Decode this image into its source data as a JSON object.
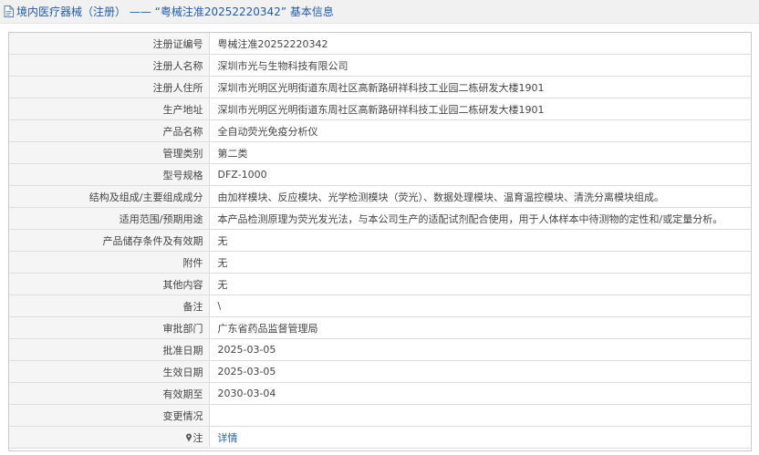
{
  "header": {
    "title": "境内医疗器械（注册） —— “粤械注准20252220342” 基本信息"
  },
  "rows": [
    {
      "label": "注册证编号",
      "value": "粤械注准20252220342"
    },
    {
      "label": "注册人名称",
      "value": "深圳市光与生物科技有限公司"
    },
    {
      "label": "注册人住所",
      "value": "深圳市光明区光明街道东周社区高新路研祥科技工业园二栋研发大楼1901"
    },
    {
      "label": "生产地址",
      "value": "深圳市光明区光明街道东周社区高新路研祥科技工业园二栋研发大楼1901"
    },
    {
      "label": "产品名称",
      "value": "全自动荧光免疫分析仪"
    },
    {
      "label": "管理类别",
      "value": "第二类"
    },
    {
      "label": "型号规格",
      "value": "DFZ-1000"
    },
    {
      "label": "结构及组成/主要组成成分",
      "value": "由加样模块、反应模块、光学检测模块（荧光）、数据处理模块、温育温控模块、清洗分离模块组成。"
    },
    {
      "label": "适用范围/预期用途",
      "value": "本产品检测原理为荧光发光法，与本公司生产的适配试剂配合使用，用于人体样本中待测物的定性和/或定量分析。"
    },
    {
      "label": "产品储存条件及有效期",
      "value": "无"
    },
    {
      "label": "附件",
      "value": "无"
    },
    {
      "label": "其他内容",
      "value": "无"
    },
    {
      "label": "备注",
      "value": "\\"
    },
    {
      "label": "审批部门",
      "value": "广东省药品监督管理局"
    },
    {
      "label": "批准日期",
      "value": "2025-03-05"
    },
    {
      "label": "生效日期",
      "value": "2025-03-05"
    },
    {
      "label": "有效期至",
      "value": "2030-03-04"
    },
    {
      "label": "变更情况",
      "value": ""
    }
  ],
  "note_row": {
    "label": "注",
    "link": "详情",
    "icon": "note-icon"
  }
}
